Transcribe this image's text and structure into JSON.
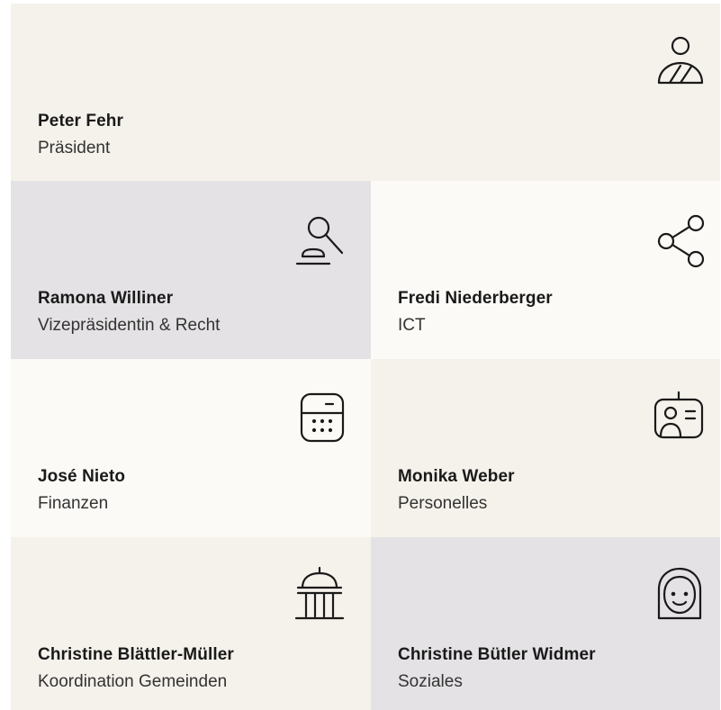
{
  "members": [
    {
      "name": "Peter Fehr",
      "role": "Präsident",
      "icon": "person-icon"
    },
    {
      "name": "Ramona Williner",
      "role": "Vizepräsidentin & Recht",
      "icon": "gavel-icon"
    },
    {
      "name": "Fredi Niederberger",
      "role": "ICT",
      "icon": "share-network-icon"
    },
    {
      "name": "José Nieto",
      "role": "Finanzen",
      "icon": "calculator-icon"
    },
    {
      "name": "Monika Weber",
      "role": "Personelles",
      "icon": "id-badge-icon"
    },
    {
      "name": "Christine Blättler-Müller",
      "role": "Koordination Gemeinden",
      "icon": "government-building-icon"
    },
    {
      "name": "Christine Bütler Widmer",
      "role": "Soziales",
      "icon": "woman-face-icon"
    }
  ],
  "colors": {
    "beige": "#f5f2eb",
    "gray": "#e4e2e4",
    "light": "#fbfaf6",
    "text": "#1a1a1a",
    "icon_stroke": "#1a1a1a"
  }
}
